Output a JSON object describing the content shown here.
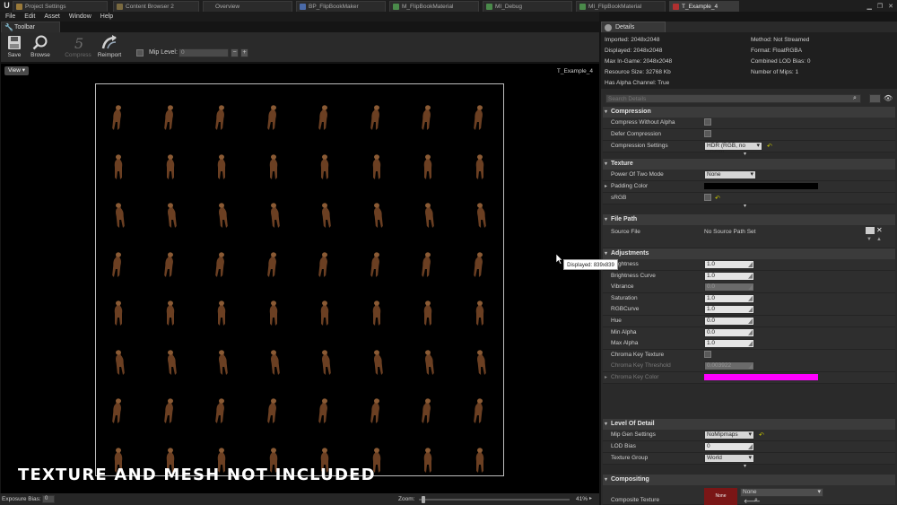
{
  "tabs": [
    {
      "label": "Project Settings",
      "icon": "settings-icon",
      "color": "#9a7a3a"
    },
    {
      "label": "Content Browser 2",
      "icon": "content-browser-icon",
      "color": "#7a6a40"
    },
    {
      "label": "Overview",
      "icon": "",
      "color": ""
    },
    {
      "label": "BP_FlipBookMaker",
      "icon": "blueprint-icon",
      "color": "#4a6aa8"
    },
    {
      "label": "M_FlipBookMaterial",
      "icon": "material-icon",
      "color": "#4a8a4a"
    },
    {
      "label": "MI_Debug",
      "icon": "material-instance-icon",
      "color": "#4a8a4a"
    },
    {
      "label": "MI_FlipBookMaterial",
      "icon": "material-instance-icon",
      "color": "#4a8a4a"
    },
    {
      "label": "T_Example_4",
      "icon": "texture-icon",
      "color": "#b03030"
    }
  ],
  "menu": [
    "File",
    "Edit",
    "Asset",
    "Window",
    "Help"
  ],
  "toolbar": {
    "tab_label": "Toolbar",
    "save_label": "Save",
    "browse_label": "Browse",
    "compress_label": "Compress",
    "reimport_label": "Reimport",
    "mip_label": "Mip Level:",
    "mip_value": "0"
  },
  "viewport": {
    "view_button": "View",
    "texture_name": "T_Example_4",
    "tooltip": "Displayed: 839x839",
    "watermark": "TEXTURE AND MESH NOT INCLUDED"
  },
  "statusbar": {
    "exposure_label": "Exposure Bias:",
    "exposure_value": "0",
    "zoom_label": "Zoom:",
    "zoom_percent": "41%",
    "zoom_level": 0.02
  },
  "details": {
    "tab_label": "Details",
    "info_left": [
      "Imported: 2048x2048",
      "Displayed: 2048x2048",
      "Max In-Game: 2048x2048",
      "Resource Size: 32768 Kb",
      "Has Alpha Channel: True"
    ],
    "info_right": [
      "Method: Not Streamed",
      "Format: FloatRGBA",
      "Combined LOD Bias: 0",
      "Number of Mips: 1"
    ],
    "search_placeholder": "Search Details",
    "compression": {
      "title": "Compression",
      "compress_without_alpha": "Compress Without Alpha",
      "defer_compression": "Defer Compression",
      "compression_settings": "Compression Settings",
      "compression_settings_value": "HDR (RGB, no sRGB)"
    },
    "texture": {
      "title": "Texture",
      "power_of_two": "Power Of Two Mode",
      "power_of_two_value": "None",
      "padding_color": "Padding Color",
      "padding_color_value": "#000000",
      "srgb": "sRGB"
    },
    "file_path": {
      "title": "File Path",
      "source_file": "Source File",
      "source_file_value": "No Source Path Set"
    },
    "adjustments": {
      "title": "Adjustments",
      "brightness": "Brightness",
      "brightness_value": "1.0",
      "brightness_curve": "Brightness Curve",
      "brightness_curve_value": "1.0",
      "vibrance": "Vibrance",
      "vibrance_value": "0.0",
      "saturation": "Saturation",
      "saturation_value": "1.0",
      "rgbcurve": "RGBCurve",
      "rgbcurve_value": "1.0",
      "hue": "Hue",
      "hue_value": "0.0",
      "min_alpha": "Min Alpha",
      "min_alpha_value": "0.0",
      "max_alpha": "Max Alpha",
      "max_alpha_value": "1.0",
      "chroma_key_texture": "Chroma Key Texture",
      "chroma_key_threshold": "Chroma Key Threshold",
      "chroma_key_threshold_value": "0.003922",
      "chroma_key_color": "Chroma Key Color",
      "chroma_key_color_value": "#ff00ff"
    },
    "level_of_detail": {
      "title": "Level Of Detail",
      "mip_gen": "Mip Gen Settings",
      "mip_gen_value": "NoMipmaps",
      "lod_bias": "LOD Bias",
      "lod_bias_value": "0",
      "texture_group": "Texture Group",
      "texture_group_value": "World"
    },
    "compositing": {
      "title": "Compositing",
      "composite_texture": "Composite Texture",
      "composite_value": "None",
      "thumb_label": "None"
    }
  }
}
